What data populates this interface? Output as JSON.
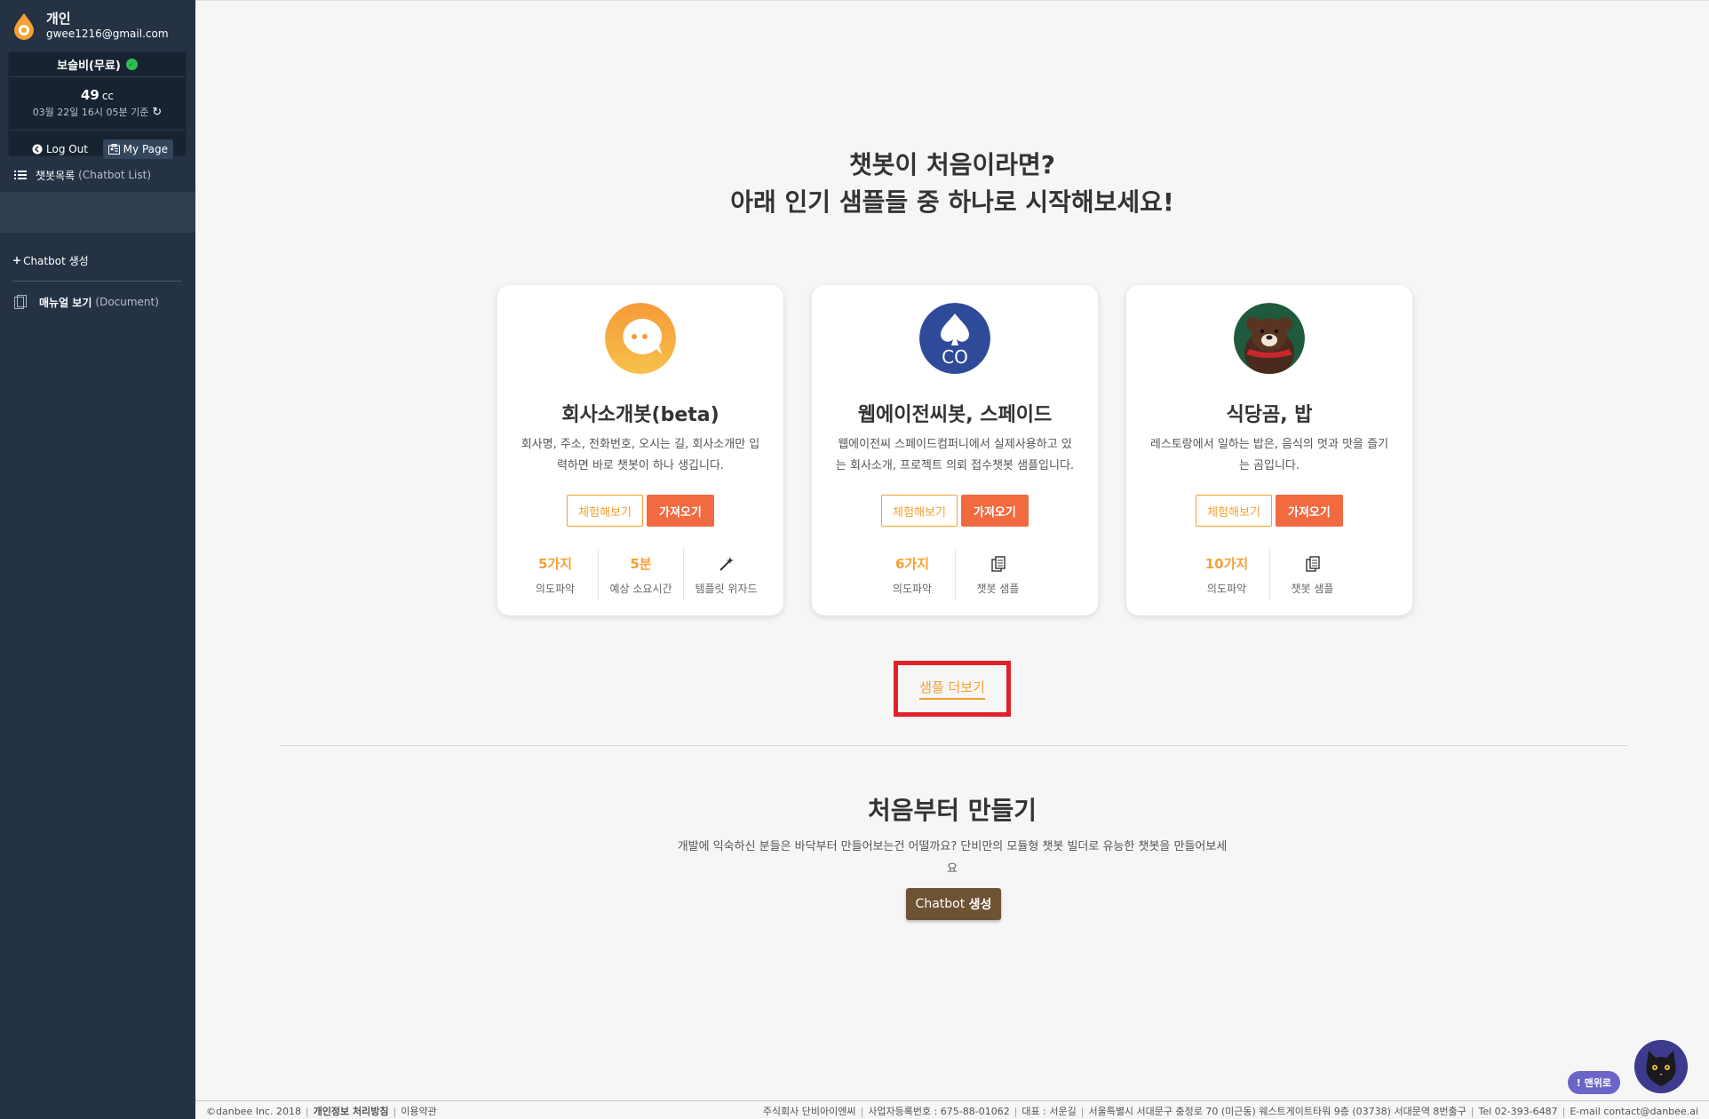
{
  "sidebar": {
    "user_name": "개인",
    "user_email": "gwee1216@gmail.com",
    "plan_title": "보슬비(무료)",
    "credit_value": "49",
    "credit_unit": "cc",
    "credit_date": "03월 22일 16시 05분 기준",
    "logout_label": "Log Out",
    "mypage_label": "My Page",
    "chatbot_list_label": "챗봇목록",
    "chatbot_list_sub": "(Chatbot List)",
    "create_label": "Chatbot 생성",
    "manual_label": "매뉴얼 보기",
    "manual_sub": "(Document)"
  },
  "hero": {
    "line1": "챗봇이 처음이라면?",
    "line2": "아래 인기 샘플들 중 하나로 시작해보세요!"
  },
  "cards": [
    {
      "title": "회사소개봇(beta)",
      "desc": "회사명, 주소, 전화번호, 오시는 길, 회사소개만 입력하면 바로 챗봇이 하나 생깁니다.",
      "try_label": "체험해보기",
      "get_label": "가져오기",
      "stats": [
        {
          "value": "5가지",
          "label": "의도파악"
        },
        {
          "value": "5분",
          "label": "예상 소요시간"
        },
        {
          "value": "",
          "label": "템플릿 위자드"
        }
      ]
    },
    {
      "title": "웹에이전씨봇, 스페이드",
      "desc": "웹에이전씨 스페이드컴퍼니에서 실제사용하고 있는 회사소개, 프로젝트 의뢰 접수챗봇 샘플입니다.",
      "try_label": "체험해보기",
      "get_label": "가져오기",
      "logo_text": "CO",
      "stats": [
        {
          "value": "6가지",
          "label": "의도파악"
        },
        {
          "value": "",
          "label": "챗봇 샘플"
        }
      ]
    },
    {
      "title": "식당곰, 밥",
      "desc": "레스토랑에서 일하는 밥은, 음식의 멋과 맛을 즐기는 곰입니다.",
      "try_label": "체험해보기",
      "get_label": "가져오기",
      "stats": [
        {
          "value": "10가지",
          "label": "의도파악"
        },
        {
          "value": "",
          "label": "챗봇 샘플"
        }
      ]
    }
  ],
  "more_label": "샘플 더보기",
  "scratch": {
    "title": "처음부터 만들기",
    "desc": "개발에 익숙하신 분들은 바닥부터 만들어보는건 어떨까요? 단비만의 모듈형 챗봇 빌더로 유능한 챗봇을 만들어보세요",
    "button_prefix": "Chatbot",
    "button_suffix": "생성"
  },
  "footer": {
    "copyright": "©danbee Inc. 2018",
    "privacy": "개인정보 처리방침",
    "terms": "이용약관",
    "company": "주식회사 단비아이엔씨",
    "bizno": "사업자등록번호 : 675-88-01062",
    "ceo": "대표 : 서운길",
    "address": "서울특별시 서대문구 충정로 70 (미근동) 웨스트게이트타워 9층 (03738) 서대문역 8번출구",
    "tel": "Tel 02-393-6487",
    "email": "E-mail contact@danbee.ai"
  },
  "chat_widget": {
    "pill_label": "! 맨위로"
  },
  "colors": {
    "sidebar": "#243244",
    "accent_orange": "#f5a032",
    "get_button": "#f26a40",
    "create_button": "#6e5234",
    "highlight_box": "#e0202a"
  }
}
